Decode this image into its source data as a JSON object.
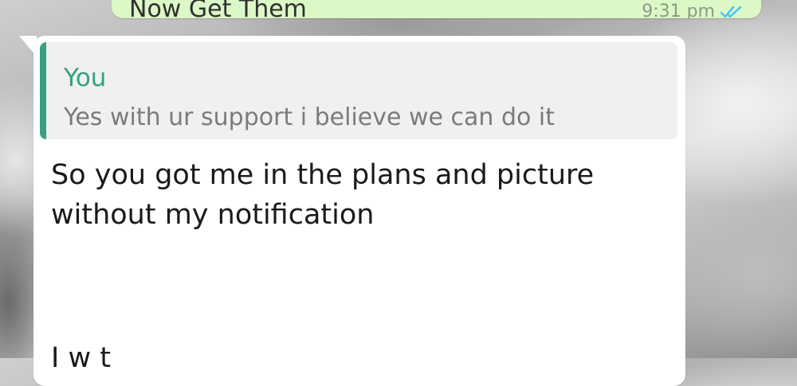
{
  "previous_message": {
    "text": "Now Get Them",
    "time": "9:31 pm",
    "status_icon": "double-check-icon",
    "bubble_color": "#dcf8c6"
  },
  "received_message": {
    "quoted": {
      "author": "You",
      "text": "Yes with ur support i believe we can do it",
      "accent_color": "#35a182"
    },
    "text": "So you got me in the plans and picture without my notification",
    "trailing_fragment": "I w t",
    "bubble_color": "#ffffff"
  }
}
